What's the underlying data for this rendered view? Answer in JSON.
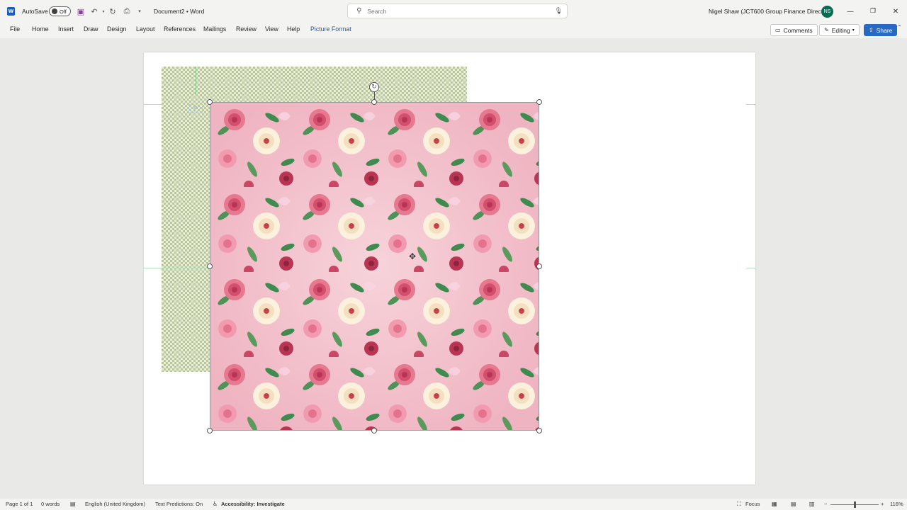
{
  "titlebar": {
    "autosave_label": "AutoSave",
    "autosave_state": "Off",
    "document_title": "Document2  •  Word",
    "search_placeholder": "Search",
    "user_name": "Nigel Shaw (JCT600 Group Finance Director)",
    "user_initials": "NS",
    "icons": [
      "word-logo",
      "save-icon",
      "undo-icon",
      "redo-icon",
      "customize-icon",
      "search-icon",
      "microphone-icon",
      "minimize-icon",
      "restore-icon",
      "close-icon"
    ]
  },
  "ribbon": {
    "tabs": [
      "File",
      "Home",
      "Insert",
      "Draw",
      "Design",
      "Layout",
      "References",
      "Mailings",
      "Review",
      "View",
      "Help",
      "Picture Format"
    ],
    "comments_label": "Comments",
    "editing_label": "Editing",
    "share_label": "Share"
  },
  "document": {
    "background_pattern": "green houndstooth",
    "image_pattern": "pink floral with roses and butterflies",
    "accent_colors": {
      "houndstooth": "#b9c79a",
      "floral_bg": "#f3c1cb",
      "rose": "#d94b6c",
      "leaf": "#3f8a4e"
    }
  },
  "statusbar": {
    "page": "Page 1 of 1",
    "words": "0 words",
    "language": "English (United Kingdom)",
    "text_predictions": "Text Predictions: On",
    "accessibility": "Accessibility: Investigate",
    "focus": "Focus",
    "zoom": "116%"
  }
}
